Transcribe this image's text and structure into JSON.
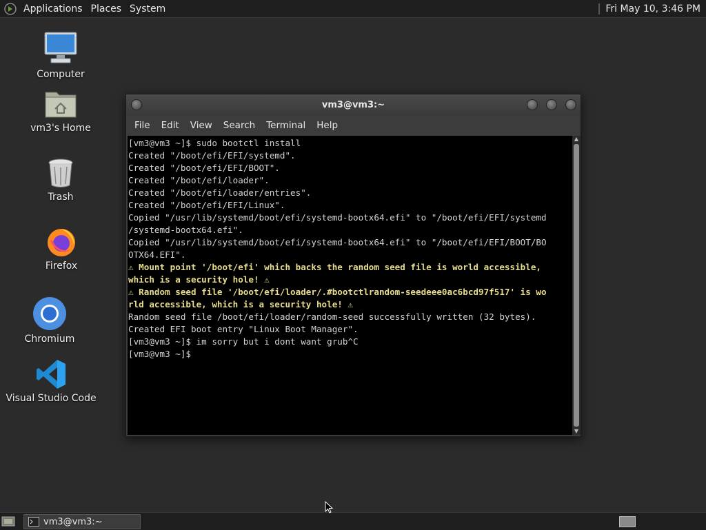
{
  "top_panel": {
    "menus": [
      "Applications",
      "Places",
      "System"
    ],
    "clock": "Fri May 10,  3:46 PM"
  },
  "desktop_icons": [
    {
      "label": "Computer",
      "icon": "computer-icon"
    },
    {
      "label": "vm3's Home",
      "icon": "home-folder-icon"
    },
    {
      "label": "Trash",
      "icon": "trash-icon"
    },
    {
      "label": "Firefox",
      "icon": "firefox-icon"
    },
    {
      "label": "Chromium",
      "icon": "chromium-icon"
    },
    {
      "label": "Visual Studio Code",
      "icon": "vscode-icon"
    }
  ],
  "window": {
    "title": "vm3@vm3:~",
    "menu": [
      "File",
      "Edit",
      "View",
      "Search",
      "Terminal",
      "Help"
    ]
  },
  "terminal_lines": [
    {
      "text": "[vm3@vm3 ~]$ sudo bootctl install",
      "warn": false
    },
    {
      "text": "Created \"/boot/efi/EFI/systemd\".",
      "warn": false
    },
    {
      "text": "Created \"/boot/efi/EFI/BOOT\".",
      "warn": false
    },
    {
      "text": "Created \"/boot/efi/loader\".",
      "warn": false
    },
    {
      "text": "Created \"/boot/efi/loader/entries\".",
      "warn": false
    },
    {
      "text": "Created \"/boot/efi/EFI/Linux\".",
      "warn": false
    },
    {
      "text": "Copied \"/usr/lib/systemd/boot/efi/systemd-bootx64.efi\" to \"/boot/efi/EFI/systemd",
      "warn": false
    },
    {
      "text": "/systemd-bootx64.efi\".",
      "warn": false
    },
    {
      "text": "Copied \"/usr/lib/systemd/boot/efi/systemd-bootx64.efi\" to \"/boot/efi/EFI/BOOT/BO",
      "warn": false
    },
    {
      "text": "OTX64.EFI\".",
      "warn": false
    },
    {
      "text": "⚠ Mount point '/boot/efi' which backs the random seed file is world accessible,",
      "warn": true
    },
    {
      "text": "which is a security hole! ⚠",
      "warn": true
    },
    {
      "text": "⚠ Random seed file '/boot/efi/loader/.#bootctlrandom-seedeee0ac6bcd97f517' is wo",
      "warn": true
    },
    {
      "text": "rld accessible, which is a security hole! ⚠",
      "warn": true
    },
    {
      "text": "Random seed file /boot/efi/loader/random-seed successfully written (32 bytes).",
      "warn": false
    },
    {
      "text": "Created EFI boot entry \"Linux Boot Manager\".",
      "warn": false
    },
    {
      "text": "[vm3@vm3 ~]$ im sorry but i dont want grub^C",
      "warn": false
    },
    {
      "text": "[vm3@vm3 ~]$ ",
      "warn": false
    }
  ],
  "taskbar": {
    "task_label": "vm3@vm3:~"
  },
  "colors": {
    "desktop": "#2b2b2b",
    "panel": "#1e1e1e",
    "terminal_bg": "#000000",
    "terminal_fg": "#d4d4d4",
    "warning_fg": "#e7dd8d"
  }
}
